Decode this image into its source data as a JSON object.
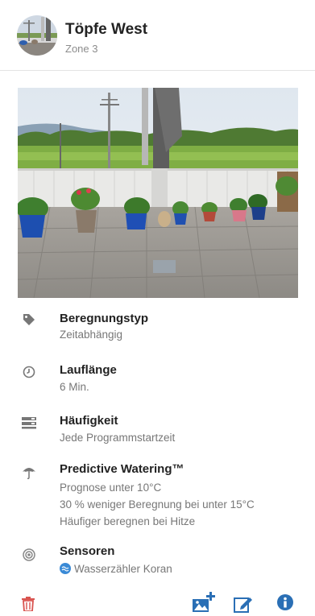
{
  "header": {
    "title": "Töpfe West",
    "subtitle": "Zone 3"
  },
  "details": [
    {
      "icon": "tag-icon",
      "title": "Beregnungstyp",
      "lines": [
        "Zeitabhängig"
      ]
    },
    {
      "icon": "clock-icon",
      "title": "Lauflänge",
      "lines": [
        "6 Min."
      ]
    },
    {
      "icon": "schedule-icon",
      "title": "Häufigkeit",
      "lines": [
        "Jede Programmstartzeit"
      ]
    },
    {
      "icon": "umbrella-icon",
      "title": "Predictive Watering™",
      "lines": [
        "Prognose unter 10°C",
        "30 % weniger Beregnung bei unter 15°C",
        "Häufiger beregnen bei Hitze"
      ]
    },
    {
      "icon": "sensor-icon",
      "title": "Sensoren",
      "lines": [
        "Wasserzähler Koran"
      ]
    }
  ],
  "footer": {
    "icons": [
      "delete-icon",
      "add-photo-icon",
      "edit-icon",
      "info-icon"
    ]
  },
  "colors": {
    "icon_gray": "#777777",
    "delete_red": "#d9534f",
    "accent_blue": "#2a6fb5",
    "sensor_badge": "#3a8ad6"
  }
}
